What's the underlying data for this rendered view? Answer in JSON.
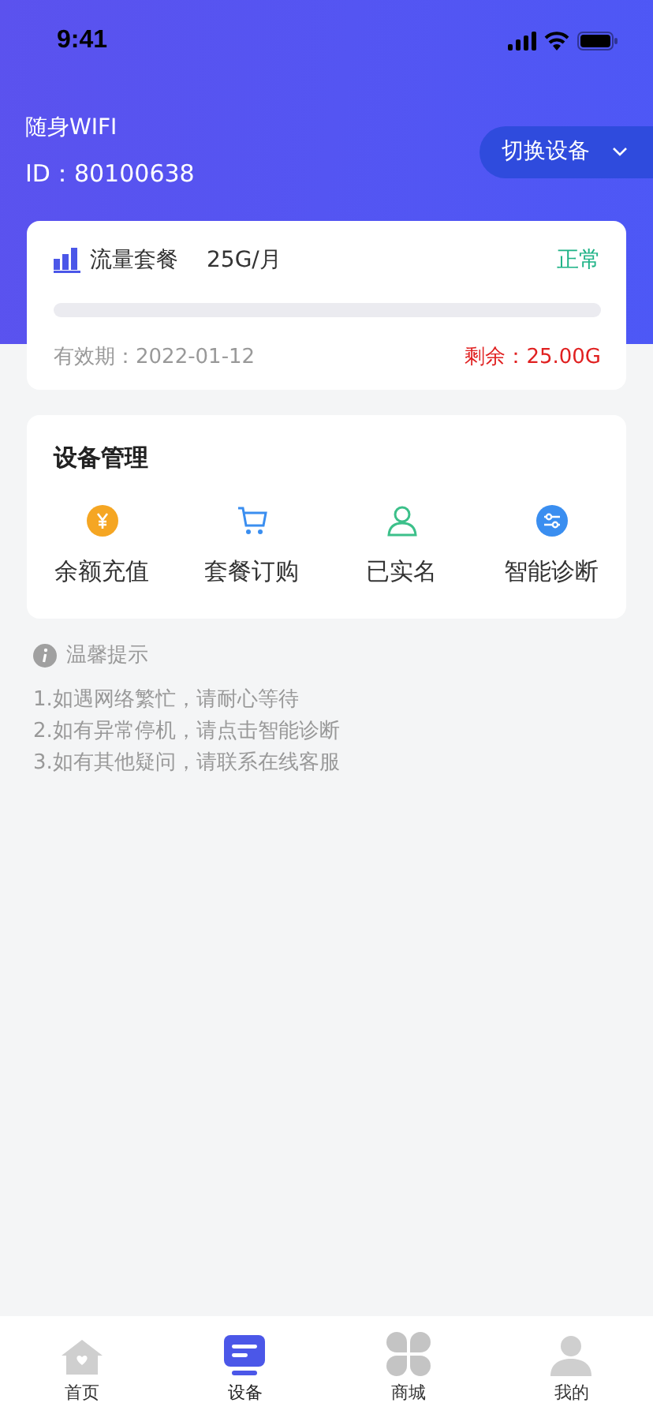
{
  "status_bar": {
    "time": "9:41"
  },
  "device": {
    "name": "随身WIFI",
    "id": "ID：80100638",
    "switch_label": "切换设备"
  },
  "plan": {
    "title": "流量套餐",
    "quota": "25G/月",
    "status": "正常",
    "level": 0,
    "validity": "有效期：2022-01-12",
    "remaining": "剩余：25.00G"
  },
  "management": {
    "title": "设备管理",
    "actions": [
      {
        "kind": "recharge",
        "label": "余额充值"
      },
      {
        "kind": "cart",
        "label": "套餐订购"
      },
      {
        "kind": "person",
        "label": "已实名"
      },
      {
        "kind": "diagnose",
        "label": "智能诊断"
      }
    ]
  },
  "tips": {
    "title": "温馨提示",
    "lines": [
      "1.如遇网络繁忙，请耐心等待",
      "2.如有异常停机，请点击智能诊断",
      "3.如有其他疑问，请联系在线客服"
    ]
  },
  "tab_bar": [
    {
      "kind": "home",
      "label": "首页",
      "selected": false
    },
    {
      "kind": "device",
      "label": "设备",
      "selected": true
    },
    {
      "kind": "shop",
      "label": "商城",
      "selected": false
    },
    {
      "kind": "profile",
      "label": "我的",
      "selected": false
    }
  ]
}
